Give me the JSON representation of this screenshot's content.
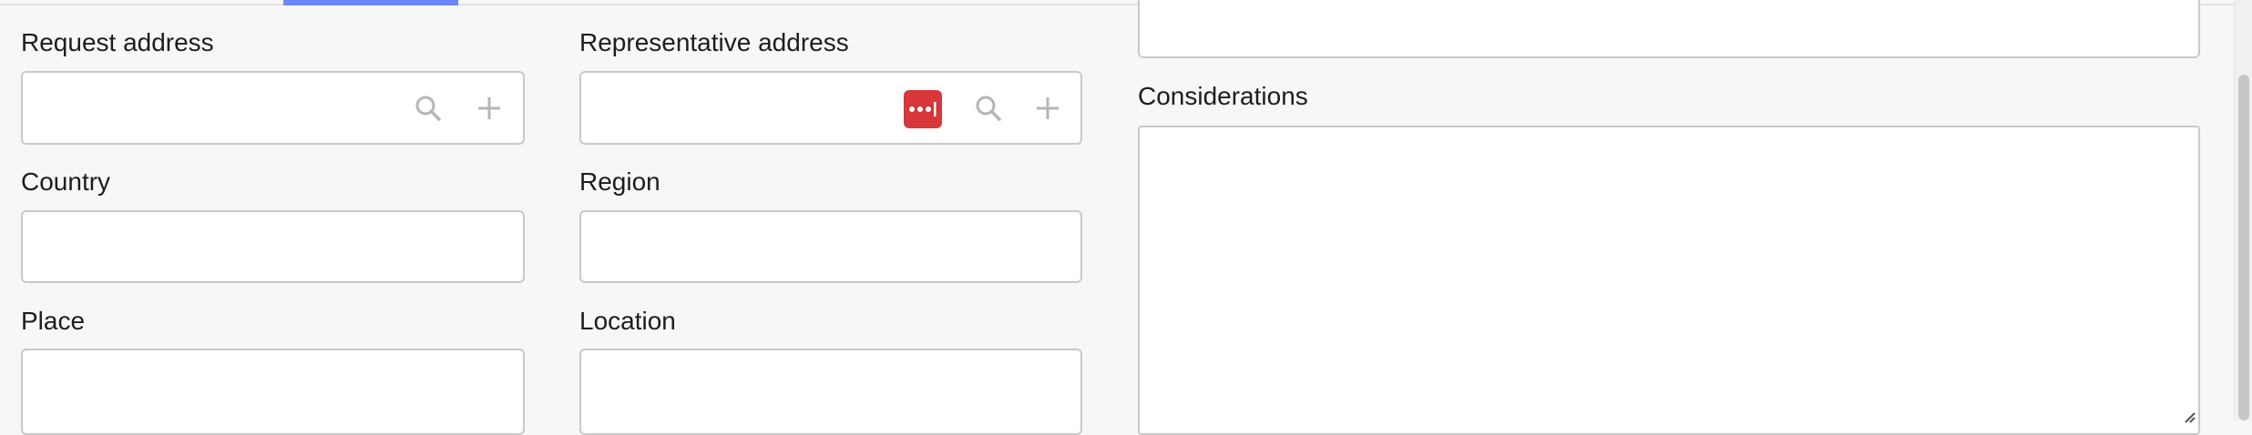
{
  "tabs": {
    "active_indicator_color": "#6b84ff"
  },
  "form": {
    "request_address": {
      "label": "Request address",
      "value": ""
    },
    "representative_address": {
      "label": "Representative address",
      "value": ""
    },
    "country": {
      "label": "Country",
      "value": ""
    },
    "region": {
      "label": "Region",
      "value": ""
    },
    "place": {
      "label": "Place",
      "value": ""
    },
    "location": {
      "label": "Location",
      "value": ""
    },
    "considerations": {
      "label": "Considerations",
      "value": ""
    }
  },
  "icons": {
    "search": "search-icon",
    "add": "plus-icon",
    "password_manager": "password-manager-icon"
  },
  "colors": {
    "accent": "#6b84ff",
    "password_manager": "#d7363a"
  }
}
